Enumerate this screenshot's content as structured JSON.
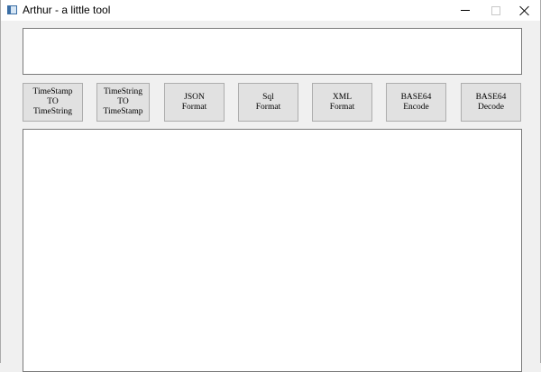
{
  "window": {
    "title": "Arthur - a little tool",
    "icon": "app-window-icon"
  },
  "title_controls": [
    "minimize-icon",
    "maximize-icon",
    "close-icon"
  ],
  "input": {
    "value": ""
  },
  "buttons": [
    {
      "label": "TimeStamp\nTO\nTimeString"
    },
    {
      "label": "TimeString\nTO\nTimeStamp"
    },
    {
      "label": "JSON\nFormat"
    },
    {
      "label": "Sql\nFormat"
    },
    {
      "label": "XML\nFormat"
    },
    {
      "label": "BASE64\nEncode"
    },
    {
      "label": "BASE64\nDecode"
    }
  ],
  "output": {
    "value": ""
  },
  "colors": {
    "background": "#f0f0f0",
    "button_face": "#e1e1e1",
    "button_border": "#adadad",
    "field_border": "#7a7a7a"
  }
}
